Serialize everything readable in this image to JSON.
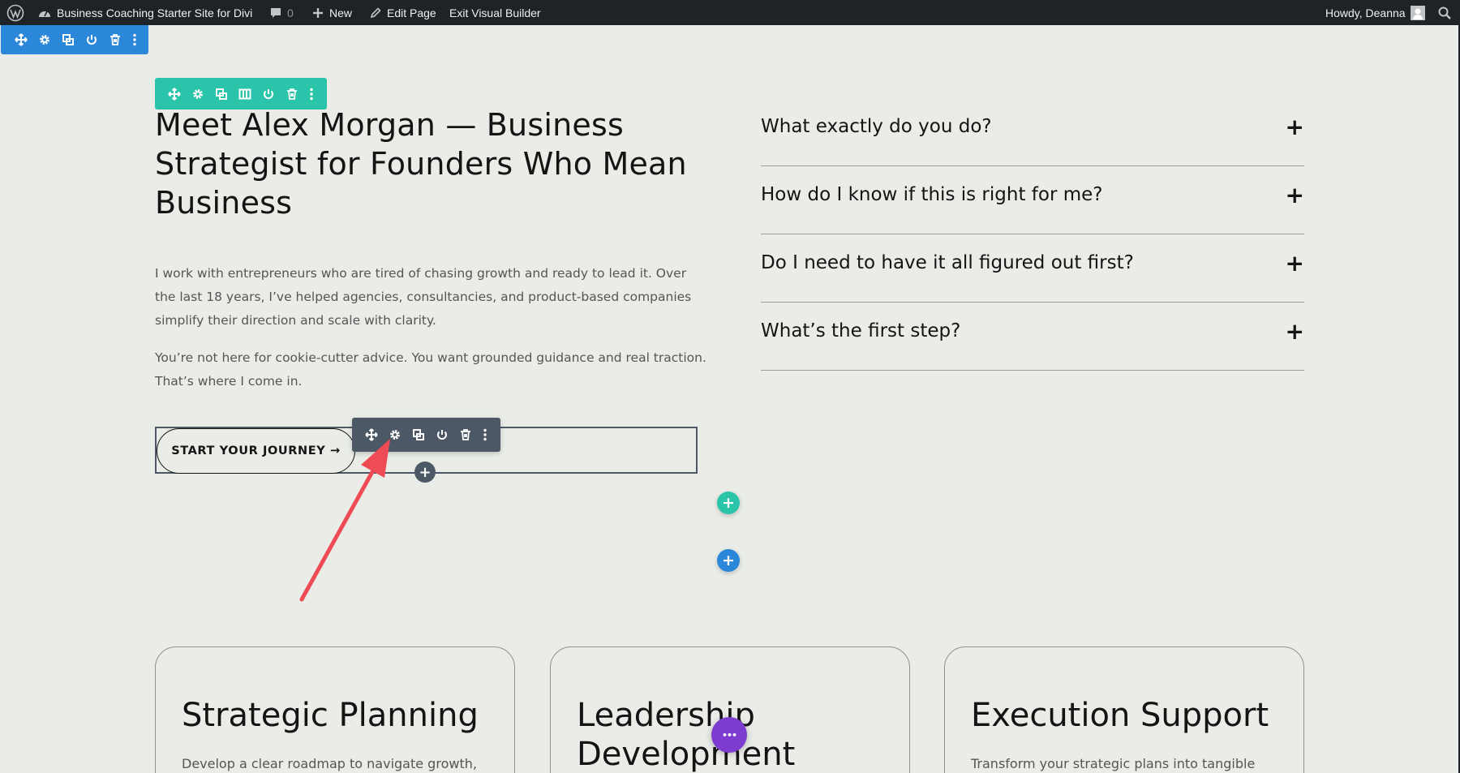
{
  "admin_bar": {
    "site_name": "Business Coaching Starter Site for Divi",
    "comments_count": "0",
    "new_label": "New",
    "edit_page_label": "Edit Page",
    "exit_builder_label": "Exit Visual Builder",
    "greeting": "Howdy, Deanna"
  },
  "hero": {
    "heading": "Meet Alex Morgan — Business Strategist for Founders Who Mean Business",
    "paragraph_1": "I work with entrepreneurs who are tired of chasing growth and ready to lead it. Over the last 18 years, I’ve helped agencies, consultancies, and product-based companies simplify their direction and scale with clarity.",
    "paragraph_2": "You’re not here for cookie-cutter advice. You want grounded guidance and real traction. That’s where I come in.",
    "cta_label": "START YOUR JOURNEY →"
  },
  "faq": {
    "items": [
      {
        "question": "What exactly do you do?",
        "icon": "+"
      },
      {
        "question": "How do I know if this is right for me?",
        "icon": "+"
      },
      {
        "question": "Do I need to have it all figured out first?",
        "icon": "+"
      },
      {
        "question": "What’s the first step?",
        "icon": "+"
      }
    ]
  },
  "cards": [
    {
      "title": "Strategic Planning",
      "description": "Develop a clear roadmap to navigate growth,"
    },
    {
      "title": "Leadership Development",
      "description": ""
    },
    {
      "title": "Execution Support",
      "description": "Transform your strategic plans into tangible"
    }
  ],
  "builder": {
    "add_glyph": "+",
    "more_glyph": "•••"
  },
  "colors": {
    "admin_bar": "#1d2327",
    "section_toolbar": "#2b87da",
    "row_toolbar": "#29c4a9",
    "module_toolbar": "#4c5866",
    "page_settings": "#7e3bd0",
    "annotation_arrow": "#ef4b55",
    "background": "#e9ece7"
  },
  "icons": [
    "wordpress-logo-icon",
    "dashboard-icon",
    "comment-icon",
    "plus-icon",
    "pencil-icon",
    "search-icon",
    "move-icon",
    "gear-icon",
    "duplicate-icon",
    "columns-icon",
    "power-icon",
    "trash-icon",
    "more-icon"
  ]
}
